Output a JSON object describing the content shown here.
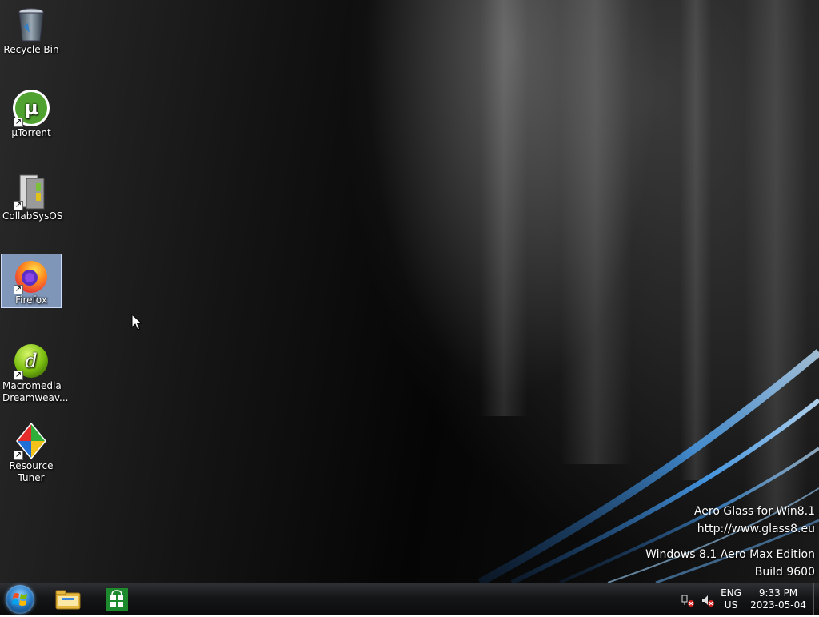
{
  "desktop": {
    "icons": [
      {
        "name": "recycle-bin",
        "label": "Recycle Bin",
        "icon": "recycle-bin-icon",
        "selected": false,
        "shortcut": false
      },
      {
        "name": "utorrent",
        "label": "µTorrent",
        "icon": "utorrent-icon",
        "selected": false,
        "shortcut": true
      },
      {
        "name": "collabsysos",
        "label": "CollabSysOS",
        "icon": "collabsysos-icon",
        "selected": false,
        "shortcut": true
      },
      {
        "name": "firefox",
        "label": "Firefox",
        "icon": "firefox-icon",
        "selected": true,
        "shortcut": true
      },
      {
        "name": "dreamweaver",
        "label_line1": "Macromedia",
        "label_line2": "Dreamweav...",
        "icon": "dreamweaver-icon",
        "selected": false,
        "shortcut": true
      },
      {
        "name": "resource-tuner",
        "label_line1": "Resource",
        "label_line2": "Tuner",
        "icon": "resource-tuner-icon",
        "selected": false,
        "shortcut": true
      }
    ],
    "watermark": {
      "line1": "Aero Glass for Win8.1",
      "line2": "http://www.glass8.eu",
      "line3": "Windows 8.1 Aero Max Edition",
      "line4": "Build 9600"
    }
  },
  "taskbar": {
    "start": "start-orb-icon",
    "pinned": [
      "file-explorer-icon",
      "store-icon"
    ],
    "tray": {
      "network": "network-disconnected-icon",
      "volume": "volume-muted-icon",
      "language_line1": "ENG",
      "language_line2": "US",
      "time": "9:33 PM",
      "date": "2023-05-04"
    }
  },
  "colors": {
    "selection": "#a0bee9",
    "taskbar": "#151618",
    "streak_blue": "#4aa8ff"
  }
}
